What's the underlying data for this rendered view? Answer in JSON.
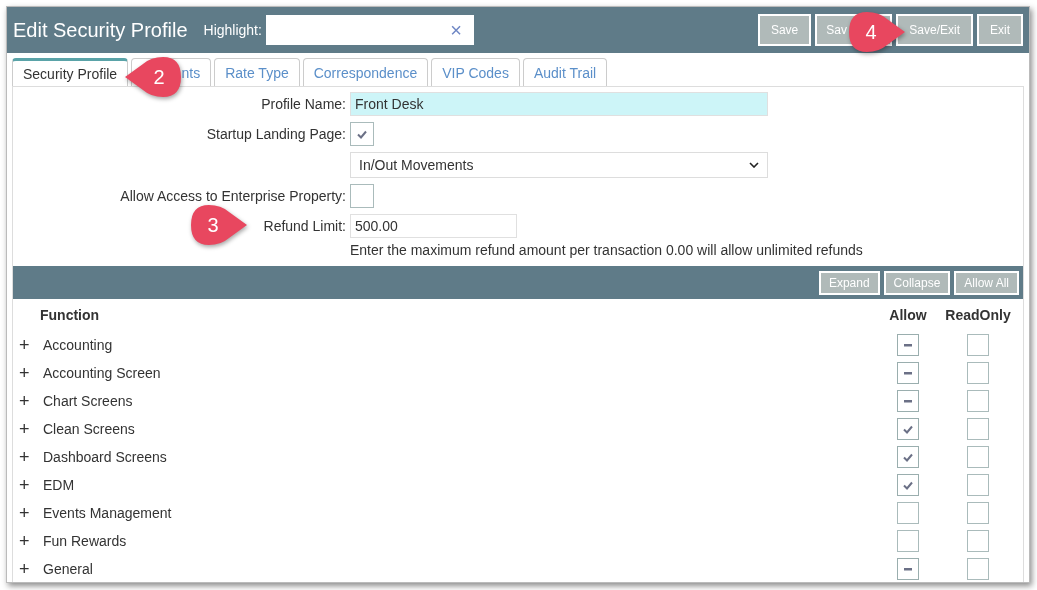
{
  "window": {
    "title": "Edit Security Profile"
  },
  "highlight": {
    "label": "Highlight:",
    "clear": "×"
  },
  "header_buttons": [
    "Save",
    "Sav",
    "Save/Exit",
    "Exit"
  ],
  "tabs": [
    {
      "label": "Security Profile",
      "selected": true
    },
    {
      "label": "nts",
      "selected": false
    },
    {
      "label": "Rate Type",
      "selected": false
    },
    {
      "label": "Correspondence",
      "selected": false
    },
    {
      "label": "VIP Codes",
      "selected": false
    },
    {
      "label": "Audit Trail",
      "selected": false
    }
  ],
  "form": {
    "profile_name": {
      "label": "Profile Name:",
      "value": "Front Desk"
    },
    "startup_landing_page": {
      "label": "Startup Landing Page:",
      "checked": true,
      "select": "In/Out Movements"
    },
    "enterprise_access": {
      "label": "Allow Access to Enterprise Property:",
      "checked": false
    },
    "refund_limit": {
      "label": "Refund Limit:",
      "value": "500.00",
      "hint": "Enter the maximum refund amount per transaction 0.00 will allow unlimited refunds"
    }
  },
  "table_buttons": [
    "Expand",
    "Collapse",
    "Allow All"
  ],
  "table": {
    "columns": [
      "Function",
      "Allow",
      "ReadOnly"
    ],
    "rows": [
      {
        "expander": "+",
        "name": "Accounting",
        "allow": true,
        "allow_indeterminate": true,
        "readonly": false
      },
      {
        "expander": "+",
        "name": "Accounting Screen",
        "allow": true,
        "allow_indeterminate": true,
        "readonly": false
      },
      {
        "expander": "+",
        "name": "Chart Screens",
        "allow": true,
        "allow_indeterminate": true,
        "readonly": false
      },
      {
        "expander": "+",
        "name": "Clean Screens",
        "allow": true,
        "allow_indeterminate": false,
        "readonly": false
      },
      {
        "expander": "+",
        "name": "Dashboard Screens",
        "allow": true,
        "allow_indeterminate": false,
        "readonly": false
      },
      {
        "expander": "+",
        "name": "EDM",
        "allow": true,
        "allow_indeterminate": false,
        "readonly": false
      },
      {
        "expander": "+",
        "name": "Events Management",
        "allow": false,
        "allow_indeterminate": false,
        "readonly": false
      },
      {
        "expander": "+",
        "name": "Fun Rewards",
        "allow": false,
        "allow_indeterminate": false,
        "readonly": false
      },
      {
        "expander": "+",
        "name": "General",
        "allow": true,
        "allow_indeterminate": true,
        "readonly": false
      }
    ]
  },
  "callouts": [
    {
      "number": "2",
      "kind": "left"
    },
    {
      "number": "3",
      "kind": "right"
    },
    {
      "number": "4",
      "kind": "right"
    }
  ]
}
